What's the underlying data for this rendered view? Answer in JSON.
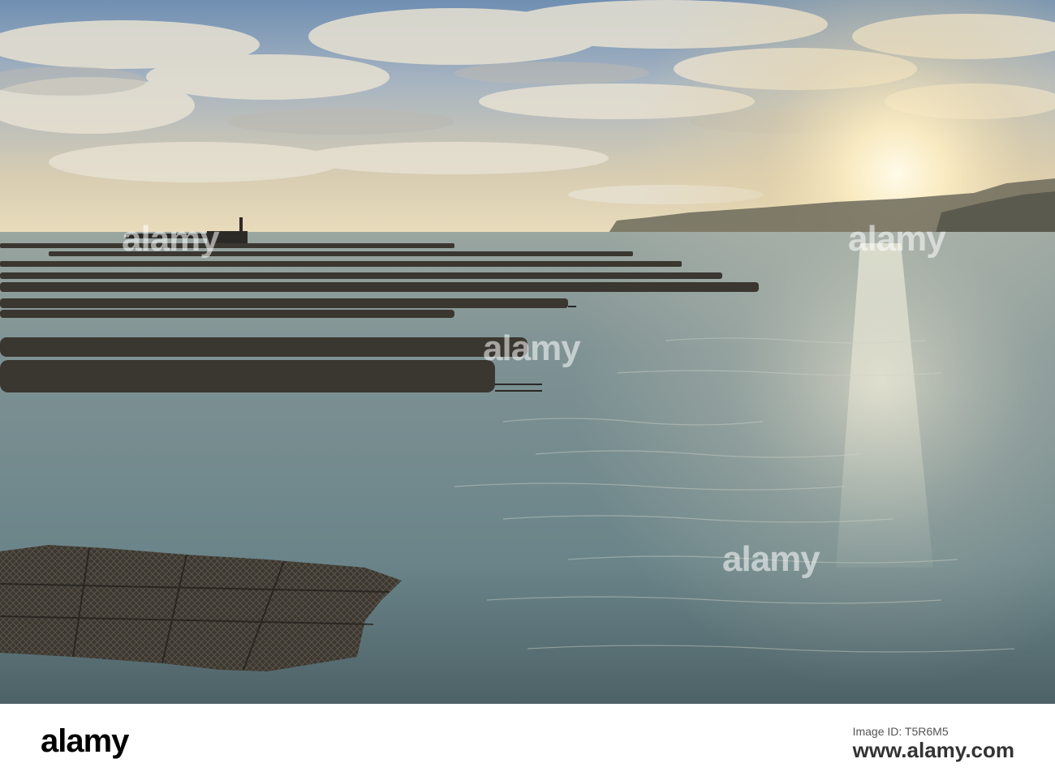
{
  "photo": {
    "description_label": "oyster beds at low tide",
    "watermark_text": "alamy",
    "colors": {
      "sky_top": "#7d98b5",
      "sky_mid": "#c9c2b0",
      "sun": "#fff6d8",
      "sea": "#6f8a90",
      "sea_dark": "#3b4c52",
      "oyster_bags": "#3a3630",
      "cliff": "#5c5a4c"
    }
  },
  "footer": {
    "logo_text": "alamy",
    "image_id_label": "Image ID: T5R6M5",
    "site_url": "www.alamy.com"
  }
}
